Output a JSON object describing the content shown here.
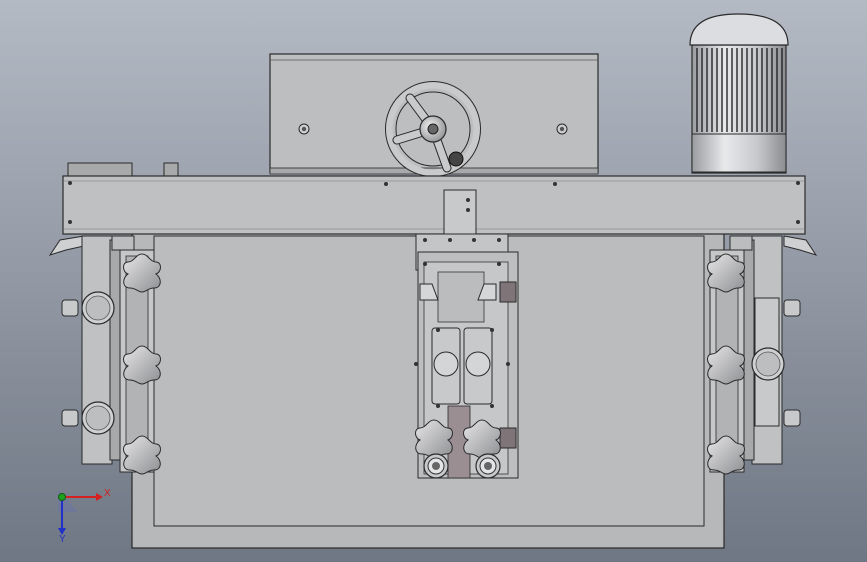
{
  "viewport": {
    "background_top": "#b4bac4",
    "background_bottom": "#6f7784"
  },
  "model": {
    "body_color": "#b9babc",
    "body_light": "#d4d5d7",
    "body_dark": "#8e8f92",
    "edge_color": "#2a2a2a",
    "motor_color": "#c6c8cc",
    "handwheel_color": "#c3c4c6",
    "knob_color": "#a9aaad",
    "slider_block_color": "#7f7478"
  },
  "triad": {
    "x_label": "X",
    "y_label": "Y",
    "x_color": "#d42020",
    "y_color": "#2030c8",
    "origin_color": "#20a020"
  }
}
